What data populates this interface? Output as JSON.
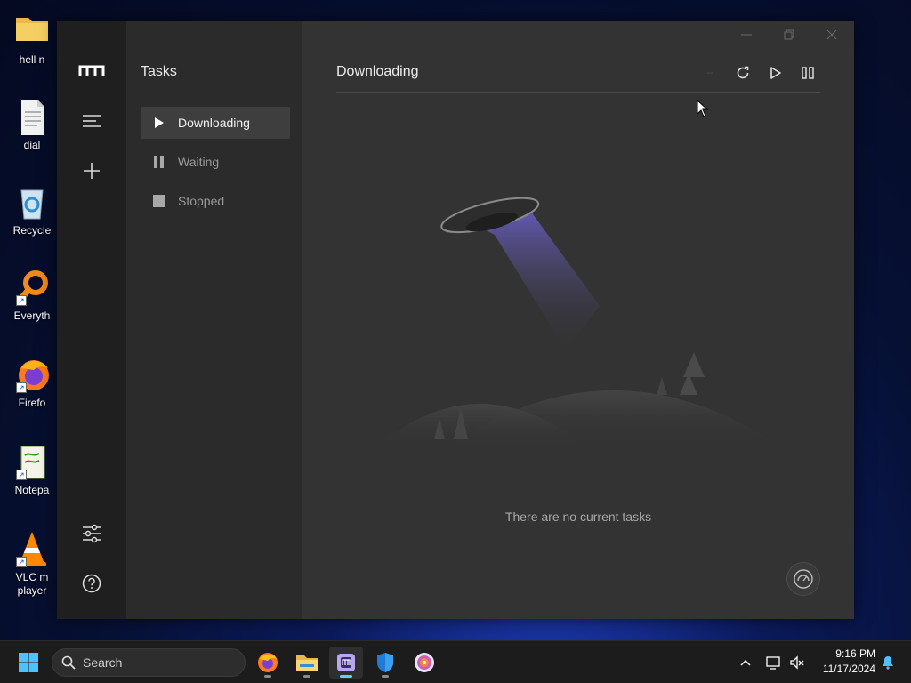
{
  "desktop": {
    "icons": [
      {
        "label": "hell n",
        "icon": "folder-icon"
      },
      {
        "label": "dial",
        "icon": "document-icon"
      },
      {
        "label": "Recycle",
        "icon": "recycle-bin-icon"
      },
      {
        "label": "Everyth",
        "icon": "everything-search-icon"
      },
      {
        "label": "Firefo",
        "icon": "firefox-icon"
      },
      {
        "label": "Notepa",
        "icon": "notepad-icon"
      },
      {
        "label": "VLC m player",
        "icon": "vlc-icon"
      }
    ]
  },
  "app": {
    "rail": {
      "logo": "motrix-logo-icon",
      "menu_icon": "menu-icon",
      "add_icon": "plus-icon",
      "settings_icon": "settings-sliders-icon",
      "help_icon": "help-icon"
    },
    "tasks_panel": {
      "title": "Tasks",
      "items": [
        {
          "label": "Downloading",
          "icon": "play-icon",
          "active": true
        },
        {
          "label": "Waiting",
          "icon": "pause-icon",
          "active": false
        },
        {
          "label": "Stopped",
          "icon": "stop-icon",
          "active": false
        }
      ]
    },
    "main": {
      "title": "Downloading",
      "toolbar": [
        "delete-icon",
        "refresh-icon",
        "resume-all-icon",
        "pause-all-icon"
      ],
      "empty_text": "There are no current tasks",
      "speedometer_icon": "speedometer-icon"
    },
    "window_controls": [
      "minimize-icon",
      "maximize-icon",
      "close-icon"
    ]
  },
  "taskbar": {
    "search_placeholder": "Search",
    "apps": [
      "firefox-icon",
      "file-explorer-icon",
      "motrix-icon",
      "windows-security-icon",
      "media-player-icon"
    ],
    "active_app": "motrix-icon",
    "clock": {
      "time": "9:16 PM",
      "date": "11/17/2024"
    }
  },
  "colors": {
    "window_bg": "#333333",
    "rail_bg": "#1f1f1f",
    "panel_bg": "#2b2b2b",
    "active_item_bg": "#3e3e3e",
    "accent": "#60cdff"
  }
}
